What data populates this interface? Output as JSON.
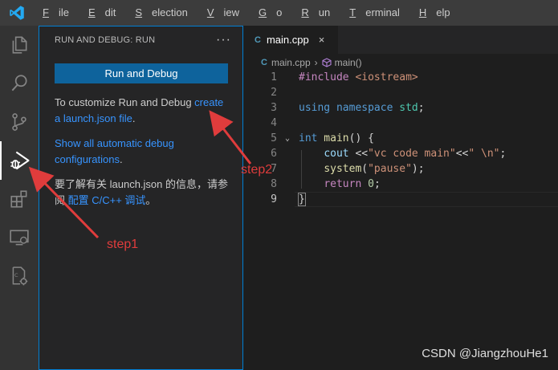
{
  "menu": [
    "File",
    "Edit",
    "Selection",
    "View",
    "Go",
    "Run",
    "Terminal",
    "Help"
  ],
  "menu_mnemonics": [
    "F",
    "E",
    "S",
    "V",
    "G",
    "R",
    "T",
    "H"
  ],
  "activity_bar": [
    "files-icon",
    "search-icon",
    "source-control-icon",
    "run-debug-icon",
    "extensions-icon",
    "remote-explorer-icon",
    "cpp-settings-icon"
  ],
  "sidebar": {
    "title": "RUN AND DEBUG: RUN",
    "more": "···",
    "button": "Run and Debug",
    "customize_text": "To customize Run and Debug ",
    "customize_link": "create a launch.json file",
    "customize_end": ".",
    "show_link": "Show all automatic debug configurations",
    "show_end": ".",
    "cn_text": "要了解有关 launch.json 的信息，请参阅 ",
    "cn_link": "配置 C/C++ 调试",
    "cn_end": "。"
  },
  "editor": {
    "tab_label": "main.cpp",
    "tab_close": "×",
    "breadcrumb_file": "main.cpp",
    "breadcrumb_symbol": "main()",
    "line_numbers": [
      "1",
      "2",
      "3",
      "4",
      "5",
      "6",
      "7",
      "8",
      "9"
    ],
    "code": {
      "l1_directive": "#include",
      "l1_header": " <iostream>",
      "l3_using": "using",
      "l3_namespace": " namespace",
      "l3_std": " std",
      "l3_semi": ";",
      "l5_int": "int",
      "l5_main": " main",
      "l5_rest": "() {",
      "l6_cout": "cout",
      "l6_op1": " <<",
      "l6_str1": "\"vc code main\"",
      "l6_op2": "<<",
      "l6_str2": "\" \\n\"",
      "l6_semi": ";",
      "l7_system": "system",
      "l7_open": "(",
      "l7_str": "\"pause\"",
      "l7_close": ");",
      "l8_return": "return",
      "l8_zero": " 0",
      "l8_semi": ";",
      "l9_brace": "}"
    }
  },
  "annotations": {
    "step1": "step1",
    "step2": "step2"
  },
  "watermark": "CSDN @JiangzhouHe1",
  "colors": {
    "accent": "#0e639c",
    "link": "#3794ff",
    "annotation": "#e03c3c",
    "focus_border": "#007fd4"
  }
}
